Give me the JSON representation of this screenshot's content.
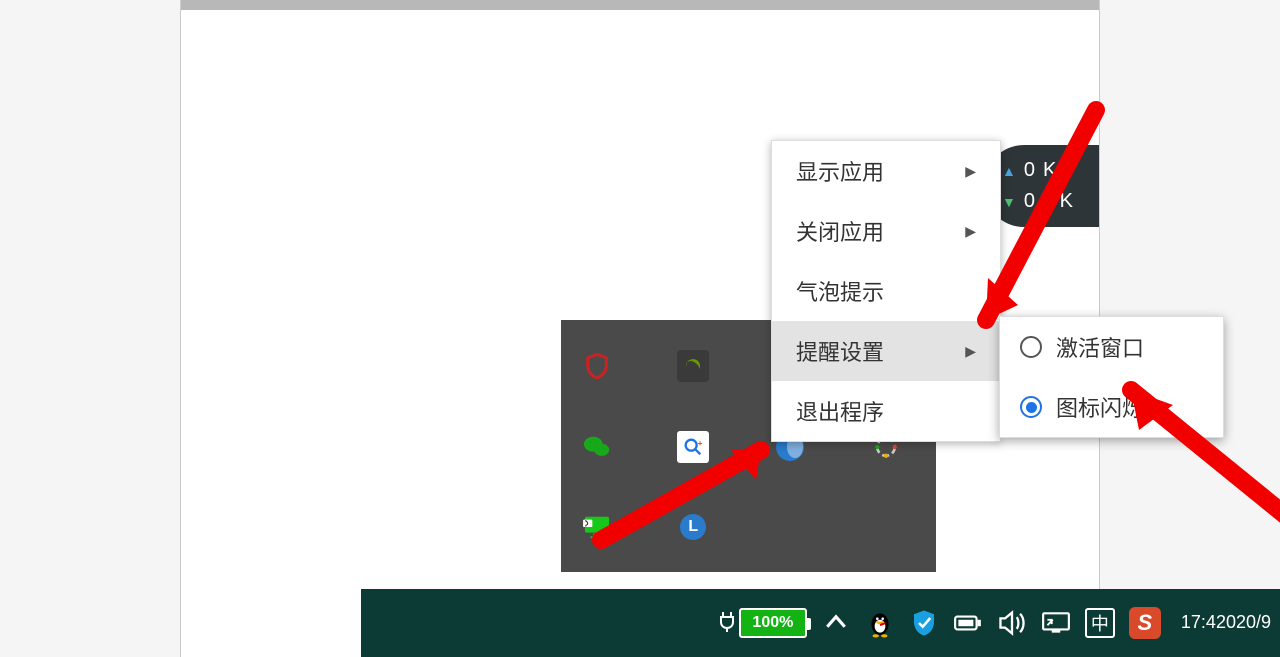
{
  "context_menu": {
    "items": [
      {
        "label": "显示应用",
        "has_submenu": true,
        "highlighted": false
      },
      {
        "label": "关闭应用",
        "has_submenu": true,
        "highlighted": false
      },
      {
        "label": "气泡提示",
        "has_submenu": false,
        "highlighted": false
      },
      {
        "label": "提醒设置",
        "has_submenu": true,
        "highlighted": true
      },
      {
        "label": "退出程序",
        "has_submenu": false,
        "highlighted": false
      }
    ]
  },
  "submenu": {
    "items": [
      {
        "label": "激活窗口",
        "selected": false
      },
      {
        "label": "图标闪烁",
        "selected": true
      }
    ]
  },
  "speed_widget": {
    "up_value": "0",
    "up_unit": "K",
    "down_value": "0.5",
    "down_unit": "K"
  },
  "tray_icons": {
    "l_letter": "L"
  },
  "taskbar": {
    "battery_percent": "100%",
    "ime_label": "中",
    "sogou_label": "S",
    "time": "17:4",
    "date": "2020/9"
  }
}
